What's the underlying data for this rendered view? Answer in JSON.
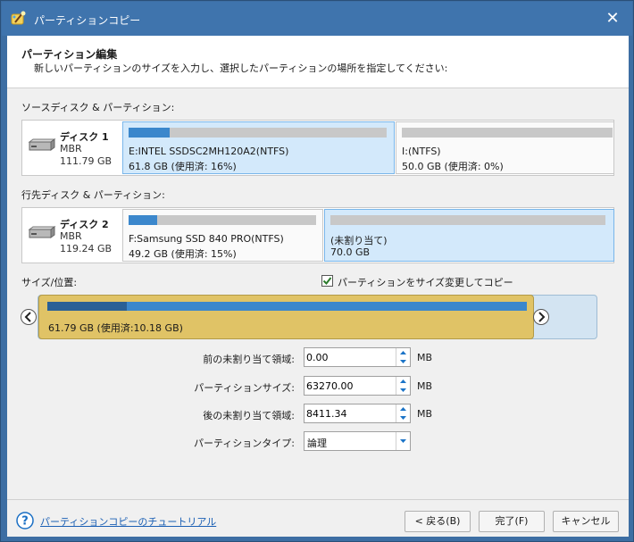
{
  "window": {
    "title": "パーティションコピー",
    "accent": "#3f74ad"
  },
  "header": {
    "title": "パーティション編集",
    "subtitle": "新しいパーティションのサイズを入力し、選択したパーティションの場所を指定してください:"
  },
  "source": {
    "label": "ソースディスク & パーティション:",
    "disk": {
      "name": "ディスク 1",
      "type": "MBR",
      "size": "111.79 GB"
    },
    "partitions": [
      {
        "name": "E:INTEL SSDSC2MH120A2(NTFS)",
        "info": "61.8 GB (使用済: 16%)",
        "used": 0.16,
        "selected": true
      },
      {
        "name": "I:(NTFS)",
        "info": "50.0 GB (使用済: 0%)",
        "used": 0.0,
        "selected": false
      }
    ]
  },
  "dest": {
    "label": "行先ディスク & パーティション:",
    "disk": {
      "name": "ディスク 2",
      "type": "MBR",
      "size": "119.24 GB"
    },
    "partitions": [
      {
        "name": "F:Samsung SSD 840 PRO(NTFS)",
        "info": "49.2 GB (使用済: 15%)",
        "used": 0.15,
        "selected": false
      },
      {
        "name": "(未割り当て)",
        "info": "70.0 GB",
        "used": 0.0,
        "selected": true
      }
    ]
  },
  "sizer": {
    "label": "サイズ/位置:",
    "checkbox_label": "パーティションをサイズ変更してコピー",
    "checked": true,
    "text": "61.79 GB (使用済:10.18 GB)",
    "used": 0.165
  },
  "fields": {
    "before": {
      "label": "前の未割り当て領域:",
      "value": "0.00",
      "unit": "MB"
    },
    "size": {
      "label": "パーティションサイズ:",
      "value": "63270.00",
      "unit": "MB"
    },
    "after": {
      "label": "後の未割り当て領域:",
      "value": "8411.34",
      "unit": "MB"
    },
    "type": {
      "label": "パーティションタイプ:",
      "value": "論理"
    }
  },
  "footer": {
    "tutorial": "パーティションコピーのチュートリアル",
    "back": "< 戻る(B)",
    "finish": "完了(F)",
    "cancel": "キャンセル"
  },
  "icons": {
    "app": "wand-icon",
    "close": "close-icon",
    "disk": "hard-drive-icon",
    "help": "help-icon",
    "left": "chevron-left-icon",
    "right": "chevron-right-icon",
    "check": "check-icon"
  },
  "colors": {
    "selected_part": "#d3e9fb",
    "used_bar": "#3b87cc",
    "sizer_partition": "#e0c366"
  }
}
